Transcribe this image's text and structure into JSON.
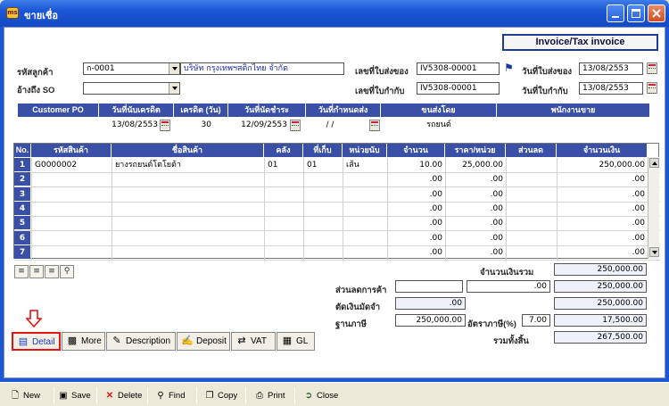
{
  "window": {
    "title": "ขายเชื่อ",
    "app_icon_text": "ms"
  },
  "invoice_title": "Invoice/Tax invoice",
  "form": {
    "customer_code_label": "รหัสลูกค้า",
    "customer_code": "ก-0001",
    "customer_name": "บริษัท กรุงเทพฯสติกไทย จำกัด",
    "ref_so_label": "อ้างถึง SO",
    "ref_so": "",
    "delivery_no_label": "เลขที่ใบส่งของ",
    "delivery_no": "IV5308-00001",
    "delivery_date_label": "วันที่ใบส่งของ",
    "delivery_date": "13/08/2553",
    "tax_no_label": "เลขที่ใบกำกับ",
    "tax_no": "IV5308-00001",
    "tax_date_label": "วันที่ใบกำกับ",
    "tax_date": "13/08/2553"
  },
  "info": {
    "headers": [
      "Customer PO",
      "วันที่นับเครดิต",
      "เครดิต (วัน)",
      "วันที่นัดชำระ",
      "วันที่กำหนดส่ง",
      "ขนส่งโดย",
      "พนักงานขาย"
    ],
    "customer_po": "",
    "credit_start": "13/08/2553",
    "credit_days": "30",
    "due_date": "12/09/2553",
    "ship_date": " / /",
    "ship_by": "รถยนต์",
    "salesman": ""
  },
  "grid": {
    "headers": [
      "No.",
      "รหัสสินค้า",
      "ชื่อสินค้า",
      "คลัง",
      "ที่เก็บ",
      "หน่วยนับ",
      "จำนวน",
      "ราคา/หน่วย",
      "ส่วนลด",
      "จำนวนเงิน"
    ],
    "rows": [
      {
        "no": "1",
        "code": "G0000002",
        "name": "ยางรถยนต์โตโยต้า",
        "wh": "01",
        "loc": "01",
        "unit": "เส้น",
        "qty": "10.00",
        "price": "25,000.00",
        "disc": "",
        "amount": "250,000.00"
      },
      {
        "no": "2",
        "code": "",
        "name": "",
        "wh": "",
        "loc": "",
        "unit": "",
        "qty": ".00",
        "price": ".00",
        "disc": "",
        "amount": ".00"
      },
      {
        "no": "3",
        "code": "",
        "name": "",
        "wh": "",
        "loc": "",
        "unit": "",
        "qty": ".00",
        "price": ".00",
        "disc": "",
        "amount": ".00"
      },
      {
        "no": "4",
        "code": "",
        "name": "",
        "wh": "",
        "loc": "",
        "unit": "",
        "qty": ".00",
        "price": ".00",
        "disc": "",
        "amount": ".00"
      },
      {
        "no": "5",
        "code": "",
        "name": "",
        "wh": "",
        "loc": "",
        "unit": "",
        "qty": ".00",
        "price": ".00",
        "disc": "",
        "amount": ".00"
      },
      {
        "no": "6",
        "code": "",
        "name": "",
        "wh": "",
        "loc": "",
        "unit": "",
        "qty": ".00",
        "price": ".00",
        "disc": "",
        "amount": ".00"
      },
      {
        "no": "7",
        "code": "",
        "name": "",
        "wh": "",
        "loc": "",
        "unit": "",
        "qty": ".00",
        "price": ".00",
        "disc": "",
        "amount": ".00"
      }
    ]
  },
  "totals": {
    "total_label": "จำนวนเงินรวม",
    "total": "250,000.00",
    "trade_discount_label": "ส่วนลดการค้า",
    "trade_discount_pct": "",
    "trade_discount_amt": ".00",
    "after_discount": "250,000.00",
    "deposit_label": "ตัดเงินมัดจำ",
    "deposit": ".00",
    "after_deposit": "250,000.00",
    "tax_base_label": "ฐานภาษี",
    "tax_base": "250,000.00",
    "vat_rate_label": "อัตราภาษี(%)",
    "vat_rate": "7.00",
    "vat_amount": "17,500.00",
    "grand_total_label": "รวมทั้งสิ้น",
    "grand_total": "267,500.00"
  },
  "tabs": [
    "Detail",
    "More",
    "Description",
    "Deposit",
    "VAT",
    "GL"
  ],
  "toolbar": [
    "New",
    "Save",
    "Delete",
    "Find",
    "Copy",
    "Print",
    "Close"
  ]
}
